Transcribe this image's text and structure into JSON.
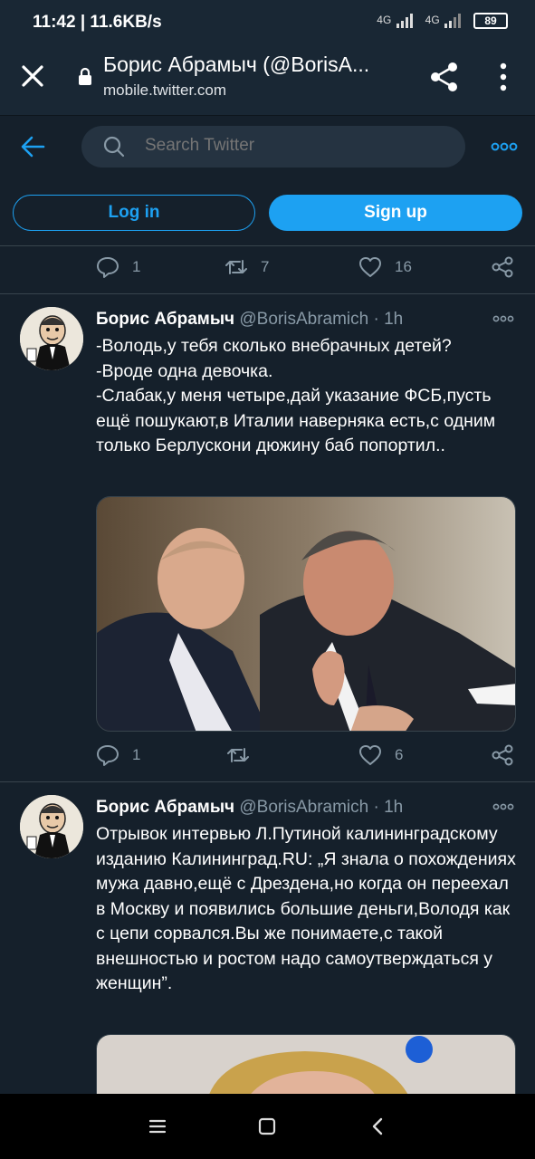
{
  "status_bar": {
    "time": "11:42 | 11.6KB/s",
    "signal_1": "4G",
    "signal_2": "4G",
    "battery": "89",
    "icons": [
      "signal-icon",
      "signal-icon",
      "battery-icon"
    ]
  },
  "browser": {
    "title": "Борис Абрамыч (@BorisA...",
    "url": "mobile.twitter.com",
    "icons": [
      "close-icon",
      "lock-icon",
      "share-icon",
      "overflow-menu-icon"
    ]
  },
  "header": {
    "search_placeholder": "Search Twitter",
    "login_label": "Log in",
    "signup_label": "Sign up",
    "icons": [
      "back-arrow-icon",
      "search-icon",
      "more-icon"
    ]
  },
  "previous_tweet": {
    "replies": "1",
    "retweets": "7",
    "likes": "16"
  },
  "tweets": [
    {
      "name": "Борис Абрамыч",
      "handle": "@BorisAbramich",
      "time": "· 1h",
      "text": "-Володь,у тебя сколько внебрачных детей?\n-Вроде одна девочка.\n-Слабак,у меня четыре,дай указание ФСБ,пусть ещё пошукают,в Италии наверняка есть,с одним только Берлускони дюжину баб попортил..",
      "replies": "1",
      "retweets": "",
      "likes": "6"
    },
    {
      "name": "Борис Абрамыч",
      "handle": "@BorisAbramich",
      "time": "· 1h",
      "text": "Отрывок интервью Л.Путиной калининградскому изданию Калининград.RU: „Я знала о похождениях мужа давно,ещё с Дрездена,но когда он переехал в Москву и появились большие деньги,Володя как с цепи сорвался.Вы же понимаете,с такой внешностью и ростом надо самоутверждаться у женщин”."
    }
  ],
  "colors": {
    "background": "#15202b",
    "accent": "#1da1f2",
    "secondary_text": "#8899a6",
    "divider": "#38444d"
  },
  "nav": {
    "icons": [
      "recent-apps-icon",
      "home-icon",
      "back-icon"
    ]
  }
}
